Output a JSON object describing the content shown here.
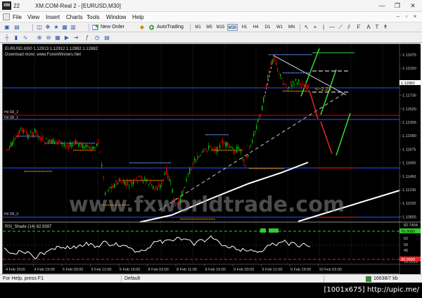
{
  "window": {
    "account_number": "22",
    "title": "XM.COM-Real 2 - [EURUSD,M30]",
    "minimize": "—",
    "restore": "❐",
    "close": "✕"
  },
  "menu": {
    "items": [
      "File",
      "View",
      "Insert",
      "Charts",
      "Tools",
      "Window",
      "Help"
    ],
    "doc_minimize": "–",
    "doc_restore": "▫",
    "doc_close": "×"
  },
  "toolbar": {
    "new_order": "New Order",
    "autotrading": "AutoTrading",
    "timeframes": [
      "M1",
      "M5",
      "M15",
      "M30",
      "H1",
      "H4",
      "D1",
      "W1",
      "MN"
    ],
    "selected_timeframe": "M30"
  },
  "chart": {
    "symbol_line": "EURUSD,M30  1.12913 1.12912 1.12882 1.12882",
    "download_line": "Download more: www.ForexWinners.Net",
    "label_sr2": "Hit SR_2",
    "label_sr3": "Hit SR_3",
    "label_sr1": "Hit SR_1",
    "order_label": "<--2.23",
    "current_price": "1.12882",
    "price_ticks": [
      "1.13375",
      "1.13160",
      "1.12950",
      "1.12735",
      "1.12520",
      "1.12305",
      "1.12090",
      "1.11875",
      "1.11660",
      "1.11450",
      "1.11235",
      "1.11020",
      "1.10805"
    ],
    "watermark": "www.fxworldtrade.com",
    "indicator_label": "RSI_Shade (14) 62.9397",
    "indicator_ticks": [
      "82.7404",
      "70.0000",
      "62",
      "50",
      "40",
      "30",
      "16.0019"
    ],
    "indicator_top_level": "70.0000",
    "indicator_bottom_level": "30.0000",
    "time_ticks": [
      "4 Feb 2016",
      "4 Feb 19:00",
      "5 Feb 03:00",
      "5 Feb 11:00",
      "5 Feb 19:00",
      "8 Feb 03:00",
      "8 Feb 11:00",
      "8 Feb 19:00",
      "9 Feb 03:00",
      "9 Feb 11:00",
      "9 Feb 19:00",
      "10 Feb 03:00"
    ]
  },
  "status": {
    "help": "For Help, press F1",
    "profile": "Default",
    "traffic": "16638/7 kb"
  },
  "caption": "[1001x675] http://upic.me/",
  "colors": {
    "bullish": "#00c800",
    "bearish": "#e00000",
    "blue_line": "#3050ff",
    "orange_dots": "#ff9900",
    "sky_dots": "#6699ff"
  }
}
